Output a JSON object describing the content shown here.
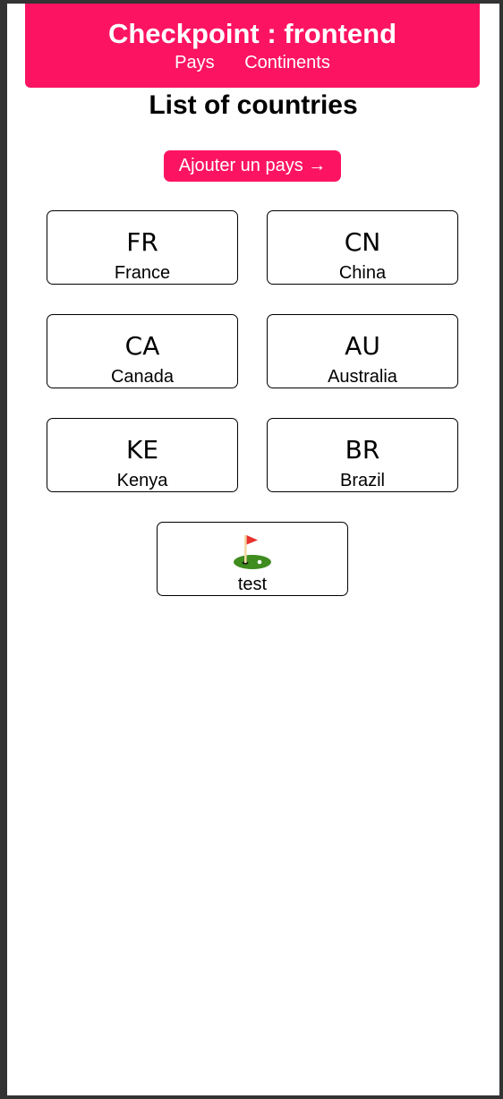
{
  "header": {
    "title": "Checkpoint : frontend",
    "nav": [
      "Pays",
      "Continents"
    ]
  },
  "page_title": "List of countries",
  "add_button_label": "Ajouter un pays →",
  "countries": [
    {
      "code": "FR",
      "name": "France"
    },
    {
      "code": "CN",
      "name": "China"
    },
    {
      "code": "CA",
      "name": "Canada"
    },
    {
      "code": "AU",
      "name": "Australia"
    },
    {
      "code": "KE",
      "name": "Kenya"
    },
    {
      "code": "BR",
      "name": "Brazil"
    },
    {
      "code": "",
      "icon": "golf-flag-icon",
      "name": "test"
    }
  ],
  "colors": {
    "accent": "#fc1463",
    "window_frame": "#333333",
    "background": "#ffffff",
    "card_border": "#000000"
  }
}
